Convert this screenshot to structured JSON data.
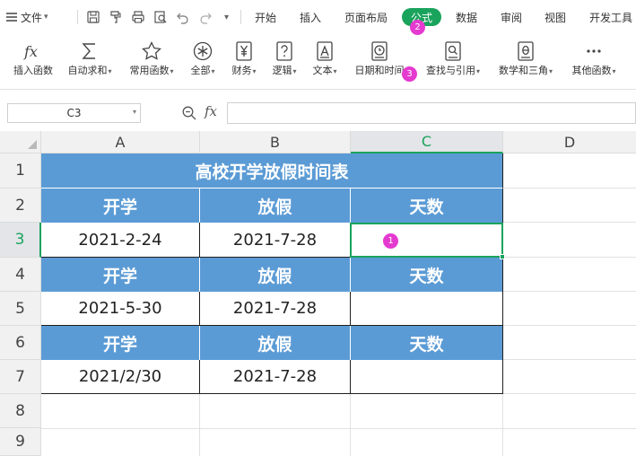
{
  "menu": {
    "file_label": "文件",
    "file_caret": "▾",
    "more_caret": "▾",
    "tabs": [
      "开始",
      "插入",
      "页面布局",
      "公式",
      "数据",
      "审阅",
      "视图",
      "开发工具"
    ],
    "active_tab": "公式"
  },
  "ribbon": {
    "buttons": [
      {
        "label": "插入函数",
        "caret": "",
        "icon": "fx-icon"
      },
      {
        "label": "自动求和",
        "caret": "▾",
        "icon": "sigma-icon"
      },
      {
        "label": "常用函数",
        "caret": "▾",
        "icon": "star-icon"
      },
      {
        "label": "全部",
        "caret": "▾",
        "icon": "asterisk-icon"
      },
      {
        "label": "财务",
        "caret": "▾",
        "icon": "yen-icon"
      },
      {
        "label": "逻辑",
        "caret": "▾",
        "icon": "question-icon"
      },
      {
        "label": "文本",
        "caret": "▾",
        "icon": "text-icon"
      },
      {
        "label": "日期和时间",
        "caret": "▾",
        "icon": "clock-icon"
      },
      {
        "label": "查找与引用",
        "caret": "▾",
        "icon": "magnifier-icon"
      },
      {
        "label": "数学和三角",
        "caret": "▾",
        "icon": "theta-icon"
      },
      {
        "label": "其他函数",
        "caret": "▾",
        "icon": "more-icon"
      }
    ]
  },
  "badges": {
    "one": "1",
    "two": "2",
    "three": "3"
  },
  "formula_bar": {
    "name_box": "C3",
    "name_caret": "▾",
    "fx": "fx",
    "formula": ""
  },
  "grid": {
    "columns": [
      "A",
      "B",
      "C",
      "D"
    ],
    "rows": [
      "1",
      "2",
      "3",
      "4",
      "5",
      "6",
      "7",
      "8",
      "9"
    ],
    "selected_cell": "C3",
    "title": "高校开学放假时间表",
    "headers": [
      "开学",
      "放假",
      "天数"
    ],
    "records": [
      {
        "start": "2021-2-24",
        "end": "2021-7-28",
        "days": ""
      },
      {
        "start": "2021-5-30",
        "end": "2021-7-28",
        "days": ""
      },
      {
        "start": "2021/2/30",
        "end": "2021-7-28",
        "days": ""
      }
    ]
  },
  "colors": {
    "accent": "#1aa35c",
    "header_fill": "#5b9bd5",
    "badge": "#e53ad0"
  }
}
